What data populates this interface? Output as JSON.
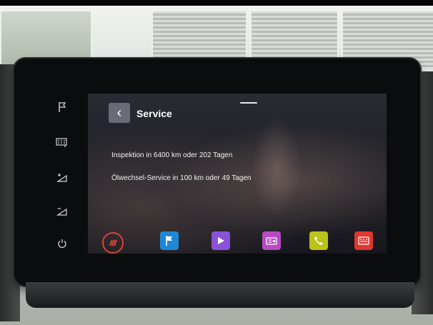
{
  "screen": {
    "title": "Service",
    "back_glyph": "‹",
    "lines": [
      "Inspektion in 6400 km oder 202 Tagen",
      "Ölwechsel-Service in 100 km oder 49 Tagen"
    ]
  },
  "side_buttons": [
    {
      "icon": "flag-icon"
    },
    {
      "icon": "keypad-icon"
    },
    {
      "icon": "volume-up-icon"
    },
    {
      "icon": "volume-down-icon"
    },
    {
      "icon": "power-icon"
    }
  ],
  "dock": [
    {
      "icon": "home-icon",
      "color": "#d94338"
    },
    {
      "icon": "navigation-flag-icon",
      "color": "#1e88d6"
    },
    {
      "icon": "media-play-icon",
      "color": "#8a52d8"
    },
    {
      "icon": "radio-icon",
      "color": "#b64bc3"
    },
    {
      "icon": "phone-icon",
      "color": "#b9c418"
    },
    {
      "icon": "car-apps-icon",
      "color": "#e0372f"
    }
  ]
}
